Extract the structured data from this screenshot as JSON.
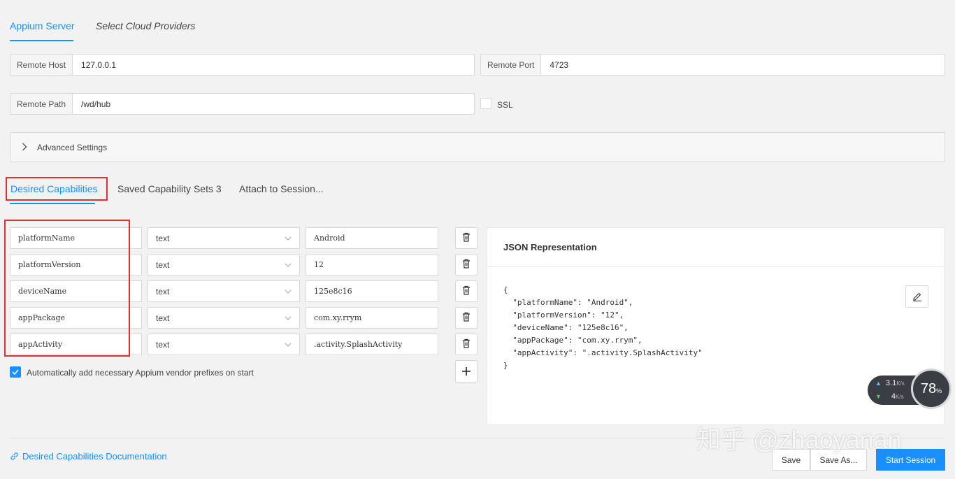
{
  "top_tabs": {
    "appium": "Appium Server",
    "cloud": "Select Cloud Providers"
  },
  "server": {
    "host_label": "Remote Host",
    "host_value": "127.0.0.1",
    "port_label": "Remote Port",
    "port_value": "4723",
    "path_label": "Remote Path",
    "path_value": "/wd/hub",
    "ssl_label": "SSL"
  },
  "advanced": {
    "label": "Advanced Settings"
  },
  "cap_tabs": {
    "desired": "Desired Capabilities",
    "saved": "Saved Capability Sets 3",
    "attach": "Attach to Session..."
  },
  "capabilities": [
    {
      "name": "platformName",
      "type": "text",
      "value": "Android"
    },
    {
      "name": "platformVersion",
      "type": "text",
      "value": "12"
    },
    {
      "name": "deviceName",
      "type": "text",
      "value": "125e8c16"
    },
    {
      "name": "appPackage",
      "type": "text",
      "value": "com.xy.rrym"
    },
    {
      "name": "appActivity",
      "type": "text",
      "value": ".activity.SplashActivity"
    }
  ],
  "auto_prefix": {
    "label": "Automatically add necessary Appium vendor prefixes on start",
    "checked": true
  },
  "json_panel": {
    "title": "JSON Representation",
    "code": "{\n  \"platformName\": \"Android\",\n  \"platformVersion\": \"12\",\n  \"deviceName\": \"125e8c16\",\n  \"appPackage\": \"com.xy.rrym\",\n  \"appActivity\": \".activity.SplashActivity\"\n}"
  },
  "net_widget": {
    "up": "3.1",
    "up_unit": "K/s",
    "down": "4",
    "down_unit": "K/s",
    "cpu": "78",
    "cpu_unit": "%"
  },
  "footer": {
    "doc_link": "Desired Capabilities Documentation",
    "save": "Save",
    "save_as": "Save As...",
    "start": "Start Session"
  },
  "watermark": "知乎 @zhaoyanan",
  "colors": {
    "accent": "#1890ff",
    "highlight_box": "#e03030"
  }
}
